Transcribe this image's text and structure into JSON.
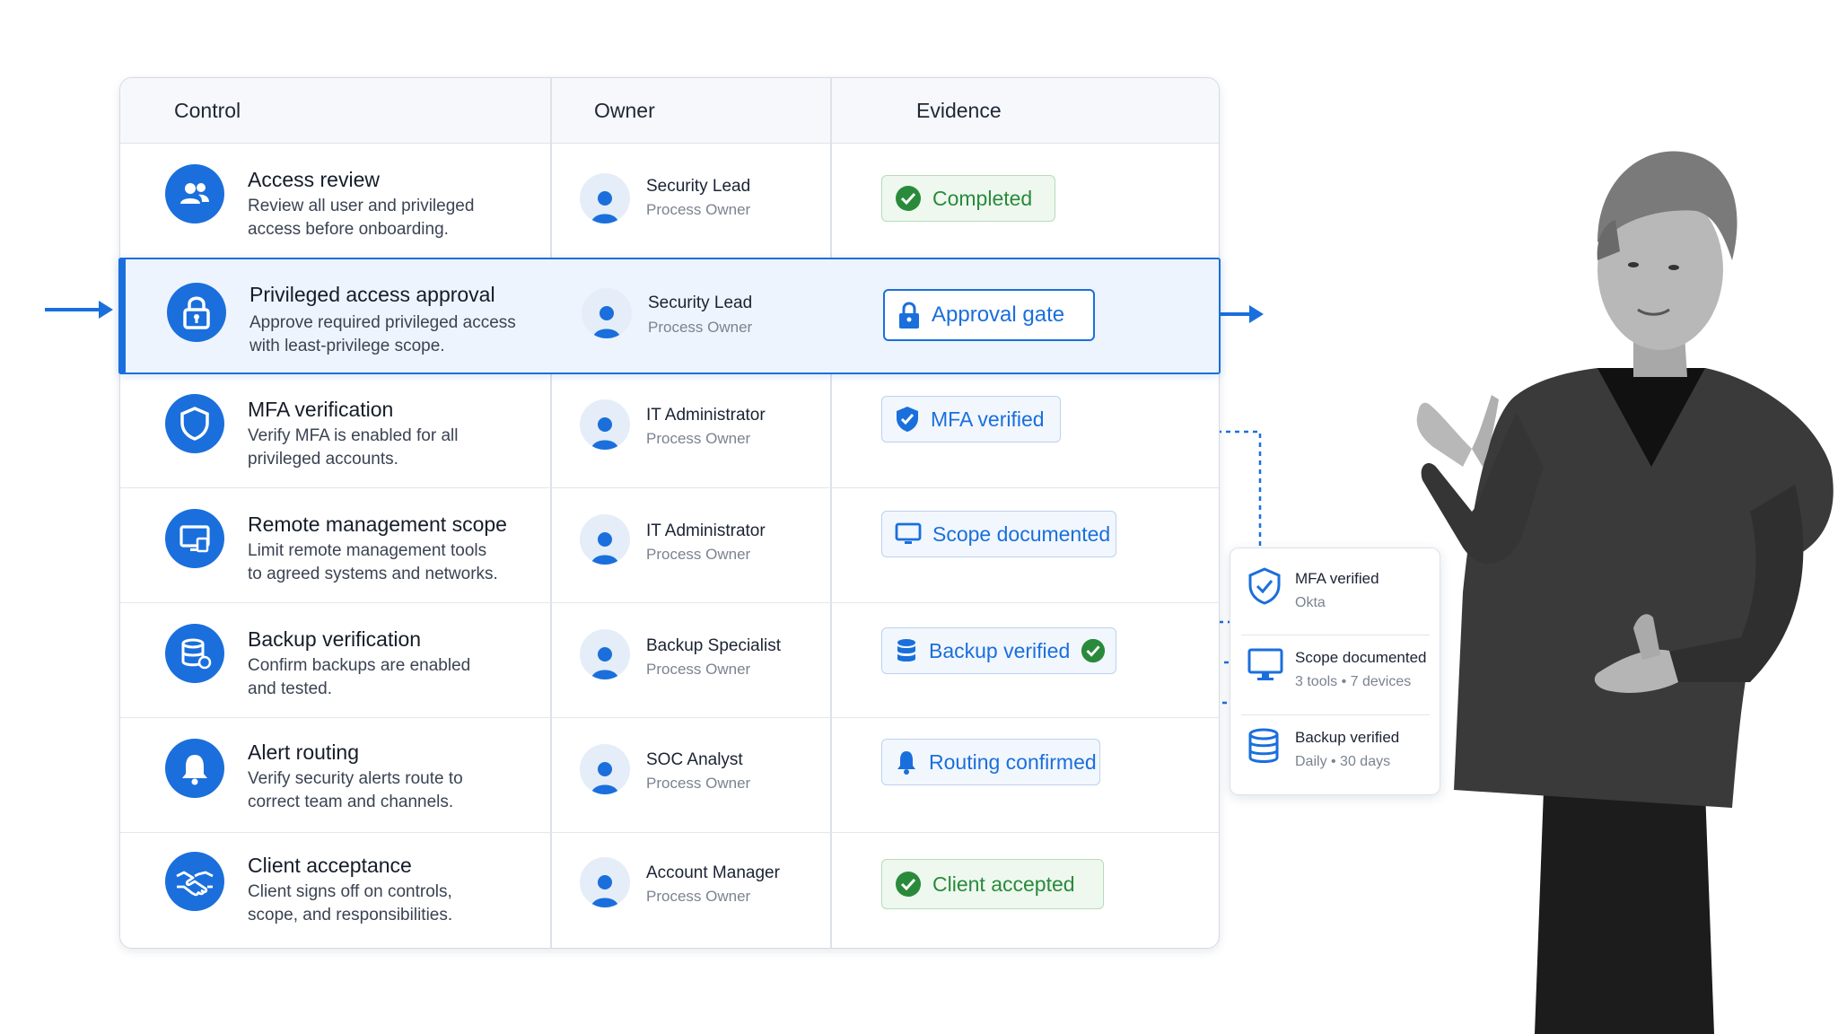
{
  "table": {
    "headers": {
      "control": "Control",
      "owner": "Owner",
      "evidence": "Evidence"
    },
    "rows": [
      {
        "title": "Access review",
        "desc_line1": "Review all user and privileged",
        "desc_line2": "access before onboarding.",
        "icon": "users-icon",
        "owner": "Security Lead",
        "role": "Process Owner",
        "badge": "Completed",
        "badge_style": "green",
        "badge_icon": "check-circle-icon"
      },
      {
        "title": "Privileged access approval",
        "desc_line1": "Approve required privileged access",
        "desc_line2": "with least-privilege scope.",
        "icon": "lock-icon",
        "owner": "Security Lead",
        "role": "Process Owner",
        "badge": "Approval gate",
        "badge_style": "strong",
        "badge_icon": "lock-icon"
      },
      {
        "title": "MFA verification",
        "desc_line1": "Verify MFA is enabled for all",
        "desc_line2": "privileged accounts.",
        "icon": "shield-icon",
        "owner": "IT Administrator",
        "role": "Process Owner",
        "badge": "MFA verified",
        "badge_style": "blue",
        "badge_icon": "shield-check-icon"
      },
      {
        "title": "Remote management scope",
        "desc_line1": "Limit remote management tools",
        "desc_line2": "to agreed systems and networks.",
        "icon": "remote-monitor-icon",
        "owner": "IT Administrator",
        "role": "Process Owner",
        "badge": "Scope documented",
        "badge_style": "blue",
        "badge_icon": "monitor-icon"
      },
      {
        "title": "Backup verification",
        "desc_line1": "Confirm backups are enabled",
        "desc_line2": "and tested.",
        "icon": "database-icon",
        "owner": "Backup Specialist",
        "role": "Process Owner",
        "badge": "Backup verified",
        "badge_style": "blue",
        "badge_icon": "database-icon"
      },
      {
        "title": "Alert routing",
        "desc_line1": "Verify security alerts route to",
        "desc_line2": "correct team and channels.",
        "icon": "bell-icon",
        "owner": "SOC Analyst",
        "role": "Process Owner",
        "badge": "Routing confirmed",
        "badge_style": "blue",
        "badge_icon": "bell-icon"
      },
      {
        "title": "Client acceptance",
        "desc_line1": "Client signs off on controls,",
        "desc_line2": "scope, and responsibilities.",
        "icon": "handshake-icon",
        "owner": "Account Manager",
        "role": "Process Owner",
        "badge": "Client accepted",
        "badge_style": "green",
        "badge_icon": "check-circle-icon"
      }
    ]
  },
  "side_card": {
    "items": [
      {
        "title": "MFA verified",
        "sub": "Okta",
        "icon": "shield-check-icon"
      },
      {
        "title": "Scope documented",
        "sub": "3 tools • 7 devices",
        "icon": "monitor-icon"
      },
      {
        "title": "Backup verified",
        "sub": "Daily • 30 days",
        "icon": "database-icon"
      }
    ]
  },
  "colors": {
    "accent": "#1a6fdc",
    "success": "#2a8a3b",
    "highlight_bg": "#eef4fd"
  }
}
